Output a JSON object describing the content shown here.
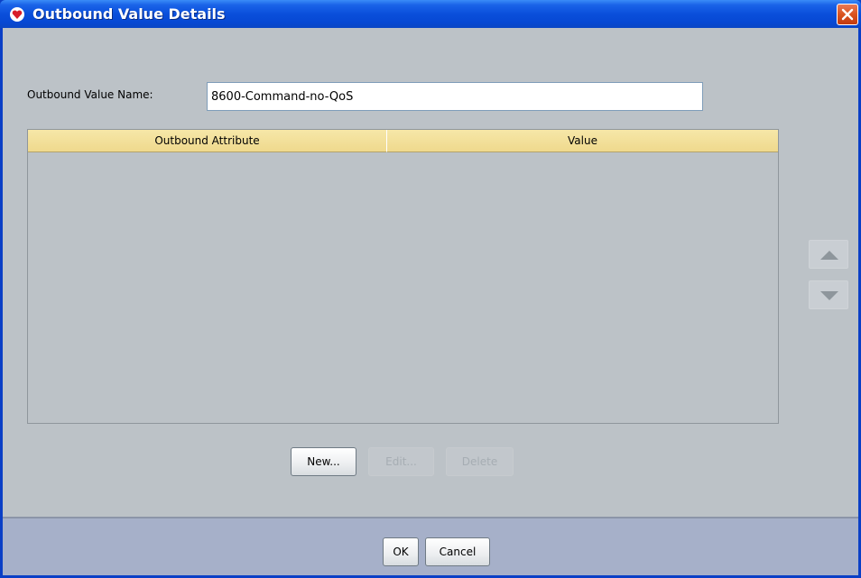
{
  "window": {
    "title": "Outbound Value Details",
    "icons": {
      "app": "red-heart-app-icon",
      "close": "close-icon"
    }
  },
  "form": {
    "name_label": "Outbound Value Name:",
    "name_value": "8600-Command-no-QoS"
  },
  "table": {
    "columns": [
      "Outbound Attribute",
      "Value"
    ],
    "rows": []
  },
  "side_buttons": {
    "up_icon": "move-up-arrow-icon",
    "down_icon": "move-down-arrow-icon"
  },
  "row_buttons": {
    "new": "New...",
    "edit": "Edit...",
    "delete": "Delete"
  },
  "footer": {
    "ok": "OK",
    "cancel": "Cancel"
  },
  "colors": {
    "titlebar": "#0a4fdb",
    "client_bg": "#bcc2c7",
    "table_header": "#f0db8e",
    "footer_bg": "#a6b0c9",
    "close_button": "#d9531f"
  }
}
